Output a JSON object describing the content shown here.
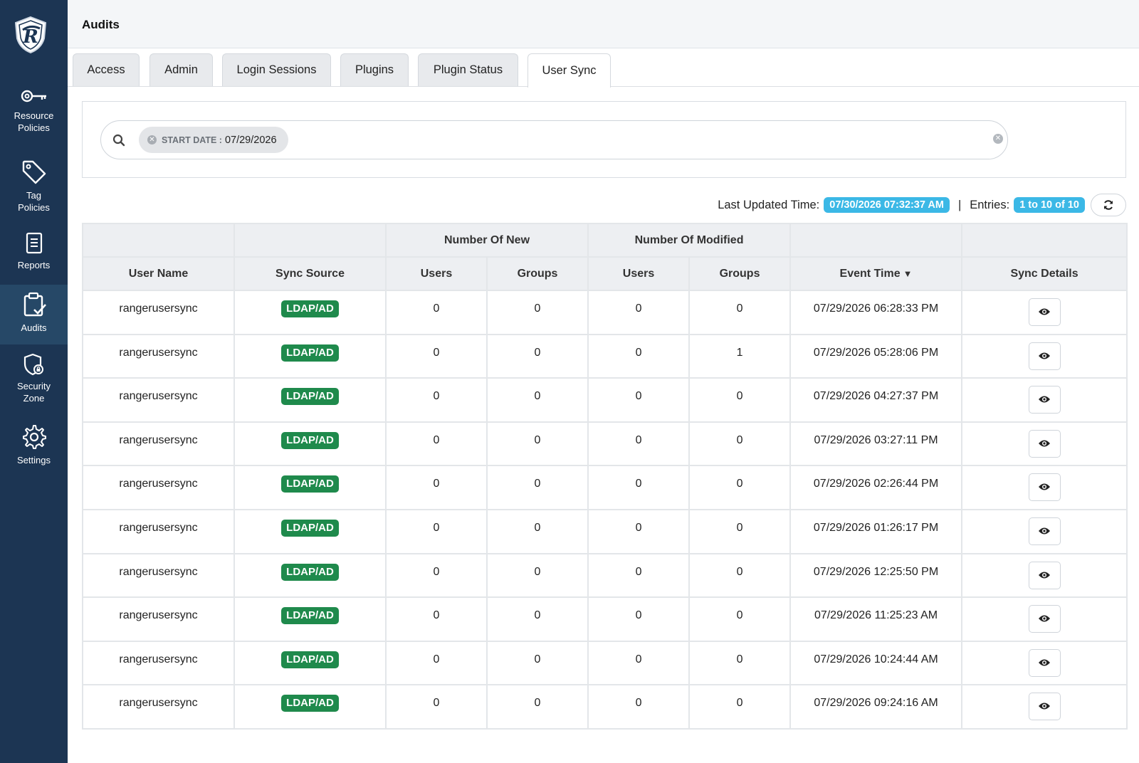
{
  "sidebar": {
    "items": [
      {
        "label_line1": "Resource",
        "label_line2": "Policies",
        "icon": "key-icon"
      },
      {
        "label_line1": "Tag",
        "label_line2": "Policies",
        "icon": "tag-icon"
      },
      {
        "label_line1": "Reports",
        "label_line2": "",
        "icon": "reports-icon"
      },
      {
        "label_line1": "Audits",
        "label_line2": "",
        "icon": "audits-icon"
      },
      {
        "label_line1": "Security",
        "label_line2": "Zone",
        "icon": "security-zone-icon"
      },
      {
        "label_line1": "Settings",
        "label_line2": "",
        "icon": "gear-icon"
      }
    ]
  },
  "header": {
    "title": "Audits"
  },
  "tabs": [
    "Access",
    "Admin",
    "Login Sessions",
    "Plugins",
    "Plugin Status",
    "User Sync"
  ],
  "active_tab": "User Sync",
  "search": {
    "filter_key": "START DATE :",
    "filter_value": "07/29/2026"
  },
  "status": {
    "last_updated_label": "Last Updated Time:",
    "last_updated_value": "07/30/2026 07:32:37 AM",
    "separator": "|",
    "entries_label": "Entries:",
    "entries_value": "1 to 10 of 10"
  },
  "table": {
    "group_headers": {
      "new": "Number Of New",
      "modified": "Number Of Modified"
    },
    "columns": {
      "user_name": "User Name",
      "sync_source": "Sync Source",
      "new_users": "Users",
      "new_groups": "Groups",
      "mod_users": "Users",
      "mod_groups": "Groups",
      "event_time": "Event Time",
      "sync_details": "Sync Details"
    },
    "rows": [
      {
        "user": "rangerusersync",
        "source": "LDAP/AD",
        "new_users": "0",
        "new_groups": "0",
        "mod_users": "0",
        "mod_groups": "0",
        "time": "07/29/2026 06:28:33 PM"
      },
      {
        "user": "rangerusersync",
        "source": "LDAP/AD",
        "new_users": "0",
        "new_groups": "0",
        "mod_users": "0",
        "mod_groups": "1",
        "time": "07/29/2026 05:28:06 PM"
      },
      {
        "user": "rangerusersync",
        "source": "LDAP/AD",
        "new_users": "0",
        "new_groups": "0",
        "mod_users": "0",
        "mod_groups": "0",
        "time": "07/29/2026 04:27:37 PM"
      },
      {
        "user": "rangerusersync",
        "source": "LDAP/AD",
        "new_users": "0",
        "new_groups": "0",
        "mod_users": "0",
        "mod_groups": "0",
        "time": "07/29/2026 03:27:11 PM"
      },
      {
        "user": "rangerusersync",
        "source": "LDAP/AD",
        "new_users": "0",
        "new_groups": "0",
        "mod_users": "0",
        "mod_groups": "0",
        "time": "07/29/2026 02:26:44 PM"
      },
      {
        "user": "rangerusersync",
        "source": "LDAP/AD",
        "new_users": "0",
        "new_groups": "0",
        "mod_users": "0",
        "mod_groups": "0",
        "time": "07/29/2026 01:26:17 PM"
      },
      {
        "user": "rangerusersync",
        "source": "LDAP/AD",
        "new_users": "0",
        "new_groups": "0",
        "mod_users": "0",
        "mod_groups": "0",
        "time": "07/29/2026 12:25:50 PM"
      },
      {
        "user": "rangerusersync",
        "source": "LDAP/AD",
        "new_users": "0",
        "new_groups": "0",
        "mod_users": "0",
        "mod_groups": "0",
        "time": "07/29/2026 11:25:23 AM"
      },
      {
        "user": "rangerusersync",
        "source": "LDAP/AD",
        "new_users": "0",
        "new_groups": "0",
        "mod_users": "0",
        "mod_groups": "0",
        "time": "07/29/2026 10:24:44 AM"
      },
      {
        "user": "rangerusersync",
        "source": "LDAP/AD",
        "new_users": "0",
        "new_groups": "0",
        "mod_users": "0",
        "mod_groups": "0",
        "time": "07/29/2026 09:24:16 AM"
      }
    ]
  },
  "colors": {
    "sidebar": "#1c3553",
    "sidebar_active": "#264867",
    "badge_info": "#3bb8e6",
    "ldap_badge": "#1f8a4c"
  }
}
